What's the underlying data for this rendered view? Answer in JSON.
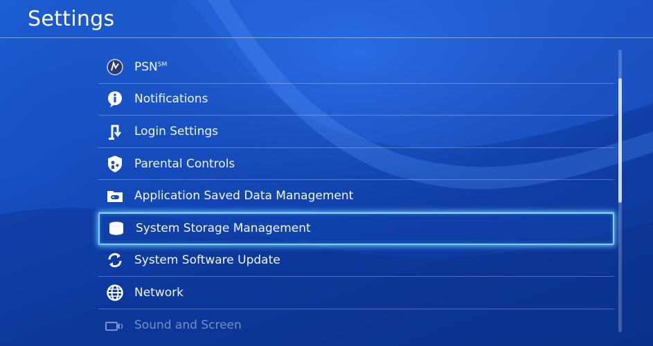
{
  "header": {
    "title": "Settings"
  },
  "menu": {
    "items": [
      {
        "label": "PSN",
        "suffix": "SM",
        "icon": "psn-icon"
      },
      {
        "label": "Notifications",
        "icon": "info-icon"
      },
      {
        "label": "Login Settings",
        "icon": "login-icon"
      },
      {
        "label": "Parental Controls",
        "icon": "parental-controls-icon"
      },
      {
        "label": "Application Saved Data Management",
        "icon": "saved-data-icon"
      },
      {
        "label": "System Storage Management",
        "icon": "storage-icon",
        "selected": true
      },
      {
        "label": "System Software Update",
        "icon": "update-icon"
      },
      {
        "label": "Network",
        "icon": "globe-icon"
      },
      {
        "label": "Sound and Screen",
        "icon": "sound-screen-icon"
      }
    ]
  },
  "scroll": {
    "position_fraction": 0.1,
    "visible_fraction": 0.44
  },
  "colors": {
    "background": "#1650c4",
    "selection_border": "#7fd0ff"
  }
}
